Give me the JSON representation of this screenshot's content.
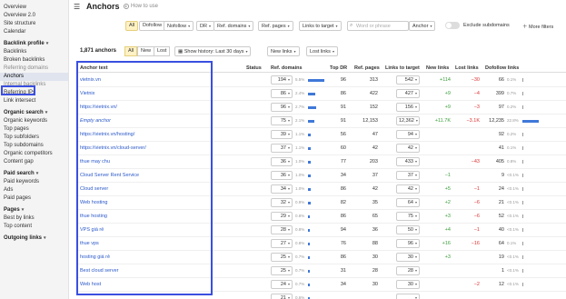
{
  "sidebar": {
    "top_items": [
      "Overview",
      "Overview 2.0",
      "Site structure",
      "Calendar"
    ],
    "sections": [
      {
        "title": "Backlink profile",
        "items": [
          {
            "label": "Backlinks",
            "dim": false,
            "active": false
          },
          {
            "label": "Broken backlinks",
            "dim": false,
            "active": false
          },
          {
            "label": "Referring domains",
            "dim": true,
            "active": false
          },
          {
            "label": "Anchors",
            "dim": false,
            "active": true
          },
          {
            "label": "Internal backlinks",
            "dim": true,
            "active": false
          },
          {
            "label": "Referring IPs",
            "dim": false,
            "active": false
          },
          {
            "label": "Link intersect",
            "dim": false,
            "active": false
          }
        ]
      },
      {
        "title": "Organic search",
        "items": [
          {
            "label": "Organic keywords"
          },
          {
            "label": "Top pages"
          },
          {
            "label": "Top subfolders"
          },
          {
            "label": "Top subdomains"
          },
          {
            "label": "Organic competitors"
          },
          {
            "label": "Content gap"
          }
        ]
      },
      {
        "title": "Paid search",
        "items": [
          {
            "label": "Paid keywords"
          },
          {
            "label": "Ads"
          },
          {
            "label": "Paid pages"
          }
        ]
      },
      {
        "title": "Pages",
        "items": [
          {
            "label": "Best by links"
          },
          {
            "label": "Top content"
          }
        ]
      },
      {
        "title": "Outgoing links",
        "items": []
      }
    ]
  },
  "header": {
    "title": "Anchors",
    "how_to": "How to use"
  },
  "filters": {
    "all": "All",
    "dofollow": "Dofollow",
    "nofollow": "Nofollow",
    "dr": "DR",
    "ref_domains": "Ref. domains",
    "ref_pages": "Ref. pages",
    "links_to_target": "Links to target",
    "search_placeholder": "Word or phrase",
    "anchor_select": "Anchor",
    "exclude_subdomains": "Exclude subdomains",
    "more_filters": "More filters"
  },
  "subbar": {
    "count": "1,871 anchors",
    "seg_all": "All",
    "seg_new": "New",
    "seg_lost": "Lost",
    "show_history": "Show history: Last 30 days",
    "new_links": "New links",
    "lost_links": "Lost links"
  },
  "columns": [
    "Anchor text",
    "Status",
    "Ref. domains",
    "Top DR",
    "Ref. pages",
    "Links to target",
    "New links",
    "Lost links",
    "Dofollow links"
  ],
  "rows": [
    {
      "anchor": "vietnix.vn",
      "italic": false,
      "rd": "194",
      "rd_pct": "5.5%",
      "rd_bar": 1.0,
      "dr": "96",
      "rp": "313",
      "ltt": "542",
      "new": "+114",
      "lost": "−30",
      "df": "66",
      "df_pct": "0.1%",
      "df_bar": 0.05
    },
    {
      "anchor": "Vietnix",
      "italic": false,
      "rd": "86",
      "rd_pct": "2.4%",
      "rd_bar": 0.45,
      "dr": "86",
      "rp": "422",
      "ltt": "427",
      "new": "+9",
      "lost": "−4",
      "df": "399",
      "df_pct": "0.7%",
      "df_bar": 0.05
    },
    {
      "anchor": "https://vietnix.vn/",
      "italic": false,
      "rd": "96",
      "rd_pct": "2.7%",
      "rd_bar": 0.5,
      "dr": "91",
      "rp": "152",
      "ltt": "156",
      "new": "+9",
      "lost": "−3",
      "df": "97",
      "df_pct": "0.2%",
      "df_bar": 0.05
    },
    {
      "anchor": "Empty anchor",
      "italic": true,
      "rd": "75",
      "rd_pct": "2.1%",
      "rd_bar": 0.4,
      "dr": "91",
      "rp": "12,153",
      "ltt": "12,362",
      "new": "+11.7K",
      "lost": "−3.1K",
      "df": "12,235",
      "df_pct": "22.8%",
      "df_bar": 1.0
    },
    {
      "anchor": "https://vietnix.vn/hosting/",
      "italic": false,
      "rd": "39",
      "rd_pct": "1.1%",
      "rd_bar": 0.15,
      "dr": "56",
      "rp": "47",
      "ltt": "94",
      "new": "",
      "lost": "",
      "df": "92",
      "df_pct": "0.2%",
      "df_bar": 0.05
    },
    {
      "anchor": "https://vietnix.vn/cloud-server/",
      "italic": false,
      "rd": "37",
      "rd_pct": "1.1%",
      "rd_bar": 0.15,
      "dr": "60",
      "rp": "42",
      "ltt": "42",
      "new": "",
      "lost": "",
      "df": "41",
      "df_pct": "0.1%",
      "df_bar": 0.05
    },
    {
      "anchor": "thue may chu",
      "italic": false,
      "rd": "36",
      "rd_pct": "1.0%",
      "rd_bar": 0.15,
      "dr": "77",
      "rp": "203",
      "ltt": "433",
      "new": "",
      "lost": "−43",
      "df": "405",
      "df_pct": "0.8%",
      "df_bar": 0.05
    },
    {
      "anchor": "Cloud Server Rent Service",
      "italic": false,
      "rd": "36",
      "rd_pct": "1.0%",
      "rd_bar": 0.15,
      "dr": "34",
      "rp": "37",
      "ltt": "37",
      "new": "−1",
      "lost": "",
      "df": "9",
      "df_pct": "<0.1%",
      "df_bar": 0.02
    },
    {
      "anchor": "Cloud server",
      "italic": false,
      "rd": "34",
      "rd_pct": "1.0%",
      "rd_bar": 0.15,
      "dr": "86",
      "rp": "42",
      "ltt": "42",
      "new": "+5",
      "lost": "−1",
      "df": "24",
      "df_pct": "<0.1%",
      "df_bar": 0.02
    },
    {
      "anchor": "Web hosting",
      "italic": false,
      "rd": "32",
      "rd_pct": "0.9%",
      "rd_bar": 0.15,
      "dr": "82",
      "rp": "35",
      "ltt": "64",
      "new": "+2",
      "lost": "−6",
      "df": "21",
      "df_pct": "<0.1%",
      "df_bar": 0.02
    },
    {
      "anchor": "thue hosting",
      "italic": false,
      "rd": "29",
      "rd_pct": "0.8%",
      "rd_bar": 0.12,
      "dr": "86",
      "rp": "65",
      "ltt": "75",
      "new": "+3",
      "lost": "−6",
      "df": "52",
      "df_pct": "<0.1%",
      "df_bar": 0.02
    },
    {
      "anchor": "VPS giá rẻ",
      "italic": false,
      "rd": "28",
      "rd_pct": "0.8%",
      "rd_bar": 0.12,
      "dr": "94",
      "rp": "36",
      "ltt": "50",
      "new": "+4",
      "lost": "−1",
      "df": "40",
      "df_pct": "<0.1%",
      "df_bar": 0.02
    },
    {
      "anchor": "thue vps",
      "italic": false,
      "rd": "27",
      "rd_pct": "0.8%",
      "rd_bar": 0.12,
      "dr": "76",
      "rp": "88",
      "ltt": "96",
      "new": "+16",
      "lost": "−16",
      "df": "64",
      "df_pct": "0.1%",
      "df_bar": 0.02
    },
    {
      "anchor": "hosting giá rẻ",
      "italic": false,
      "rd": "25",
      "rd_pct": "0.7%",
      "rd_bar": 0.1,
      "dr": "86",
      "rp": "30",
      "ltt": "30",
      "new": "+3",
      "lost": "",
      "df": "19",
      "df_pct": "<0.1%",
      "df_bar": 0.02
    },
    {
      "anchor": "Best cloud server",
      "italic": false,
      "rd": "25",
      "rd_pct": "0.7%",
      "rd_bar": 0.1,
      "dr": "31",
      "rp": "28",
      "ltt": "28",
      "new": "",
      "lost": "",
      "df": "1",
      "df_pct": "<0.1%",
      "df_bar": 0.02
    },
    {
      "anchor": "Web host",
      "italic": false,
      "rd": "24",
      "rd_pct": "0.7%",
      "rd_bar": 0.1,
      "dr": "34",
      "rp": "30",
      "ltt": "30",
      "new": "",
      "lost": "−2",
      "df": "12",
      "df_pct": "<0.1%",
      "df_bar": 0.02
    },
    {
      "anchor": "",
      "italic": false,
      "rd": "21",
      "rd_pct": "0.6%",
      "rd_bar": 0.1,
      "dr": "",
      "rp": "",
      "ltt": "",
      "new": "",
      "lost": "",
      "df": "",
      "df_pct": "",
      "df_bar": 0
    }
  ],
  "colors": {
    "accent": "#3f78d8",
    "positive": "#3a9d3a",
    "negative": "#dd3333",
    "highlight": "#3a4fe0"
  }
}
